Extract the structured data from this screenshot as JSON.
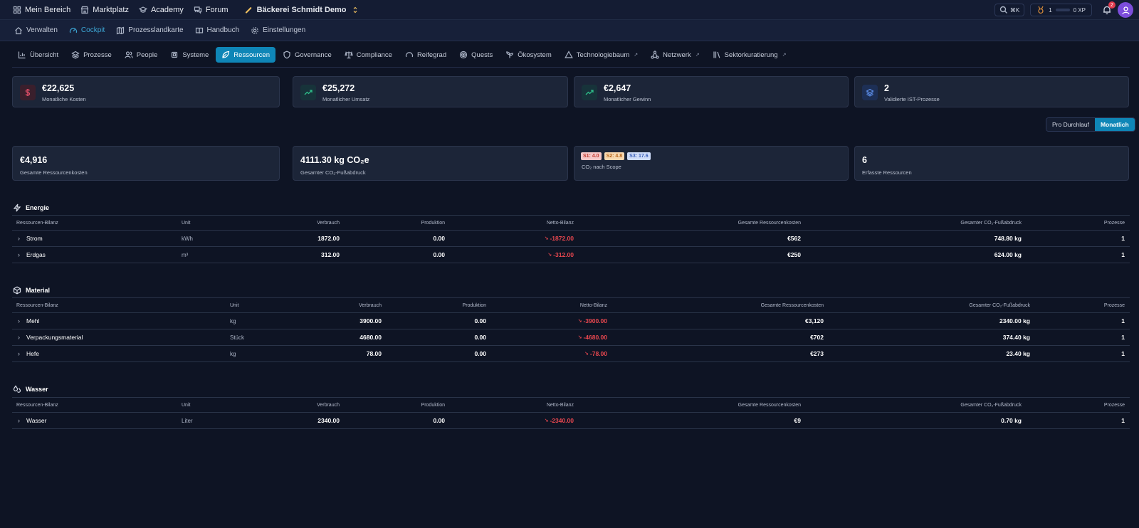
{
  "topnav": {
    "items": [
      {
        "label": "Mein Bereich",
        "icon": "grid-icon"
      },
      {
        "label": "Marktplatz",
        "icon": "store-icon"
      },
      {
        "label": "Academy",
        "icon": "graduation-cap-icon"
      },
      {
        "label": "Forum",
        "icon": "chat-icon"
      }
    ],
    "tenant": "Bäckerei Schmidt Demo",
    "search_shortcut": "⌘K",
    "xp_level": "1",
    "xp_label": "0 XP",
    "notification_count": "2"
  },
  "subnav": {
    "items": [
      {
        "label": "Verwalten",
        "icon": "home-icon"
      },
      {
        "label": "Cockpit",
        "icon": "gauge-icon",
        "active": true
      },
      {
        "label": "Prozesslandkarte",
        "icon": "map-icon"
      },
      {
        "label": "Handbuch",
        "icon": "book-icon"
      },
      {
        "label": "Einstellungen",
        "icon": "gear-icon"
      }
    ]
  },
  "tabs": [
    {
      "label": "Übersicht",
      "icon": "bar-chart-icon"
    },
    {
      "label": "Prozesse",
      "icon": "layers-icon"
    },
    {
      "label": "People",
      "icon": "users-icon"
    },
    {
      "label": "Systeme",
      "icon": "cpu-icon"
    },
    {
      "label": "Ressourcen",
      "icon": "leaf-icon",
      "active": true
    },
    {
      "label": "Governance",
      "icon": "shield-icon"
    },
    {
      "label": "Compliance",
      "icon": "scale-icon"
    },
    {
      "label": "Reifegrad",
      "icon": "gauge-icon"
    },
    {
      "label": "Quests",
      "icon": "target-icon"
    },
    {
      "label": "Ökosystem",
      "icon": "sprout-icon"
    },
    {
      "label": "Technologiebaum",
      "icon": "triangle-icon",
      "external": true
    },
    {
      "label": "Netzwerk",
      "icon": "network-icon",
      "external": true
    },
    {
      "label": "Sektorkuratierung",
      "icon": "library-icon",
      "external": true
    }
  ],
  "summary_cards": [
    {
      "value": "€22,625",
      "label": "Monatliche Kosten",
      "icon": "dollar-icon"
    },
    {
      "value": "€25,272",
      "label": "Monatlicher Umsatz",
      "icon": "trend-up-icon"
    },
    {
      "value": "€2,647",
      "label": "Monatlicher Gewinn",
      "icon": "trend-up-icon"
    },
    {
      "value": "2",
      "label": "Validierte IST-Prozesse",
      "icon": "layers-icon"
    }
  ],
  "period_toggle": {
    "options": [
      "Pro Durchlauf",
      "Monatlich"
    ],
    "selected": "Monatlich"
  },
  "resource_cards": [
    {
      "value": "€4,916",
      "label": "Gesamte Ressourcenkosten"
    },
    {
      "value": "4111.30 kg CO₂e",
      "label": "Gesamter CO₂-Fußabdruck"
    },
    {
      "scopes": [
        "S1: 4.0",
        "S2: 4.8",
        "S3: 17.6"
      ],
      "label": "CO₂ nach Scope"
    },
    {
      "value": "6",
      "label": "Erfasste Ressourcen"
    }
  ],
  "columns": [
    "Ressourcen-Bilanz",
    "Unit",
    "Verbrauch",
    "Produktion",
    "Netto-Bilanz",
    "Gesamte Ressourcenkosten",
    "Gesamter CO₂-Fußabdruck",
    "Prozesse"
  ],
  "sections": [
    {
      "title": "Energie",
      "icon": "zap-icon",
      "rows": [
        {
          "name": "Strom",
          "unit": "kWh",
          "verbrauch": "1872.00",
          "produktion": "0.00",
          "netto": "-1872.00",
          "kosten": "€562",
          "co2": "748.80 kg",
          "prozesse": "1"
        },
        {
          "name": "Erdgas",
          "unit": "m³",
          "verbrauch": "312.00",
          "produktion": "0.00",
          "netto": "-312.00",
          "kosten": "€250",
          "co2": "624.00 kg",
          "prozesse": "1"
        }
      ]
    },
    {
      "title": "Material",
      "icon": "box-icon",
      "rows": [
        {
          "name": "Mehl",
          "unit": "kg",
          "verbrauch": "3900.00",
          "produktion": "0.00",
          "netto": "-3900.00",
          "kosten": "€3,120",
          "co2": "2340.00 kg",
          "prozesse": "1"
        },
        {
          "name": "Verpackungsmaterial",
          "unit": "Stück",
          "verbrauch": "4680.00",
          "produktion": "0.00",
          "netto": "-4680.00",
          "kosten": "€702",
          "co2": "374.40 kg",
          "prozesse": "1"
        },
        {
          "name": "Hefe",
          "unit": "kg",
          "verbrauch": "78.00",
          "produktion": "0.00",
          "netto": "-78.00",
          "kosten": "€273",
          "co2": "23.40 kg",
          "prozesse": "1"
        }
      ]
    },
    {
      "title": "Wasser",
      "icon": "droplets-icon",
      "rows": [
        {
          "name": "Wasser",
          "unit": "Liter",
          "verbrauch": "2340.00",
          "produktion": "0.00",
          "netto": "-2340.00",
          "kosten": "€9",
          "co2": "0.70 kg",
          "prozesse": "1"
        }
      ]
    }
  ],
  "colors": {
    "accent": "#0f86b7",
    "negative": "#e8474f",
    "background": "#0e1424",
    "card": "#1c2538"
  }
}
